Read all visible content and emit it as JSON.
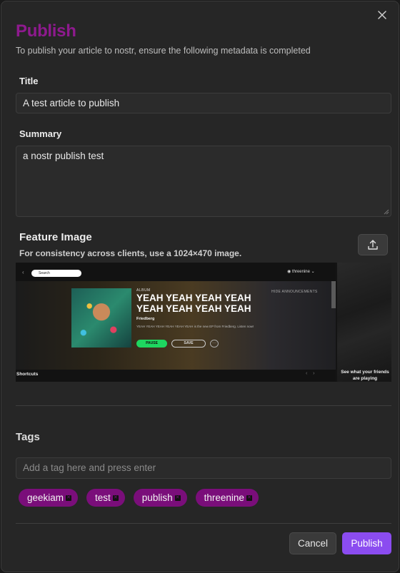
{
  "dialog": {
    "title": "Publish",
    "subtitle": "To publish your article to nostr, ensure the following metadata is completed"
  },
  "fields": {
    "title_label": "Title",
    "title_value": "A test article to publish",
    "summary_label": "Summary",
    "summary_value": "a nostr publish test"
  },
  "feature_image": {
    "title": "Feature Image",
    "hint": "For consistency across clients, use a 1024×470 image.",
    "preview": {
      "search_text": "Search",
      "user_name": "threenine",
      "album_tag": "ALBUM",
      "album_title": "YEAH YEAH YEAH YEAH YEAH YEAH YEAH YEAH",
      "artist": "Friedberg",
      "description": "YEAH YEAH YEAH YEAH YEAH YEAH is the new EP from Friedberg. Listen now!",
      "hide_label": "HIDE ANNOUNCEMENTS",
      "pause_label": "PAUSE",
      "save_label": "SAVE",
      "more_label": "···",
      "shortcuts_label": "Shortcuts",
      "friends_text": "See what your friends are playing"
    }
  },
  "tags": {
    "label": "Tags",
    "input_placeholder": "Add a tag here and press enter",
    "items": [
      "geekiam",
      "test",
      "publish",
      "threenine"
    ]
  },
  "actions": {
    "cancel_label": "Cancel",
    "publish_label": "Publish"
  },
  "colors": {
    "title": "#8e1a8e",
    "tag_bg": "#7a0e7a",
    "publish_bg": "#8b4cf0"
  },
  "icons": {
    "close": "close-icon",
    "upload": "upload-icon"
  }
}
